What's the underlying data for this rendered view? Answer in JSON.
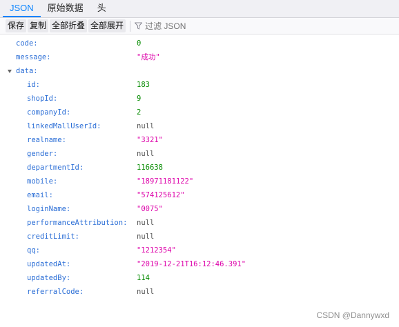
{
  "tabs": [
    {
      "label": "JSON",
      "active": true
    },
    {
      "label": "原始数据",
      "active": false
    },
    {
      "label": "头",
      "active": false
    }
  ],
  "toolbar": {
    "save": "保存",
    "copy": "复制",
    "collapse_all": "全部折叠",
    "expand_all": "全部展开",
    "filter_placeholder": "过滤 JSON",
    "filter_icon": "funnel-icon"
  },
  "rows": [
    {
      "key": "code:",
      "value": "0",
      "type": "num"
    },
    {
      "key": "message:",
      "value": "\"成功\"",
      "type": "str"
    },
    {
      "key": "data:",
      "value": "",
      "type": "obj"
    },
    {
      "key": "id:",
      "value": "183",
      "type": "num"
    },
    {
      "key": "shopId:",
      "value": "9",
      "type": "num"
    },
    {
      "key": "companyId:",
      "value": "2",
      "type": "num"
    },
    {
      "key": "linkedMallUserId:",
      "value": "null",
      "type": "null"
    },
    {
      "key": "realname:",
      "value": "\"3321\"",
      "type": "str"
    },
    {
      "key": "gender:",
      "value": "null",
      "type": "null"
    },
    {
      "key": "departmentId:",
      "value": "116638",
      "type": "num"
    },
    {
      "key": "mobile:",
      "value": "\"18971181122\"",
      "type": "str"
    },
    {
      "key": "email:",
      "value": "\"574125612\"",
      "type": "str"
    },
    {
      "key": "loginName:",
      "value": "\"0075\"",
      "type": "str"
    },
    {
      "key": "performanceAttribution:",
      "value": "null",
      "type": "null"
    },
    {
      "key": "creditLimit:",
      "value": "null",
      "type": "null"
    },
    {
      "key": "qq:",
      "value": "\"1212354\"",
      "type": "str"
    },
    {
      "key": "updatedAt:",
      "value": "\"2019-12-21T16:12:46.391\"",
      "type": "str"
    },
    {
      "key": "updatedBy:",
      "value": "114",
      "type": "num"
    },
    {
      "key": "referralCode:",
      "value": "null",
      "type": "null"
    }
  ],
  "colors": {
    "key": "#2b6ed6",
    "number": "#058b00",
    "string": "#dd00a9",
    "null": "#555555",
    "accent": "#0a84ff"
  },
  "watermark": "CSDN @Dannywxd"
}
